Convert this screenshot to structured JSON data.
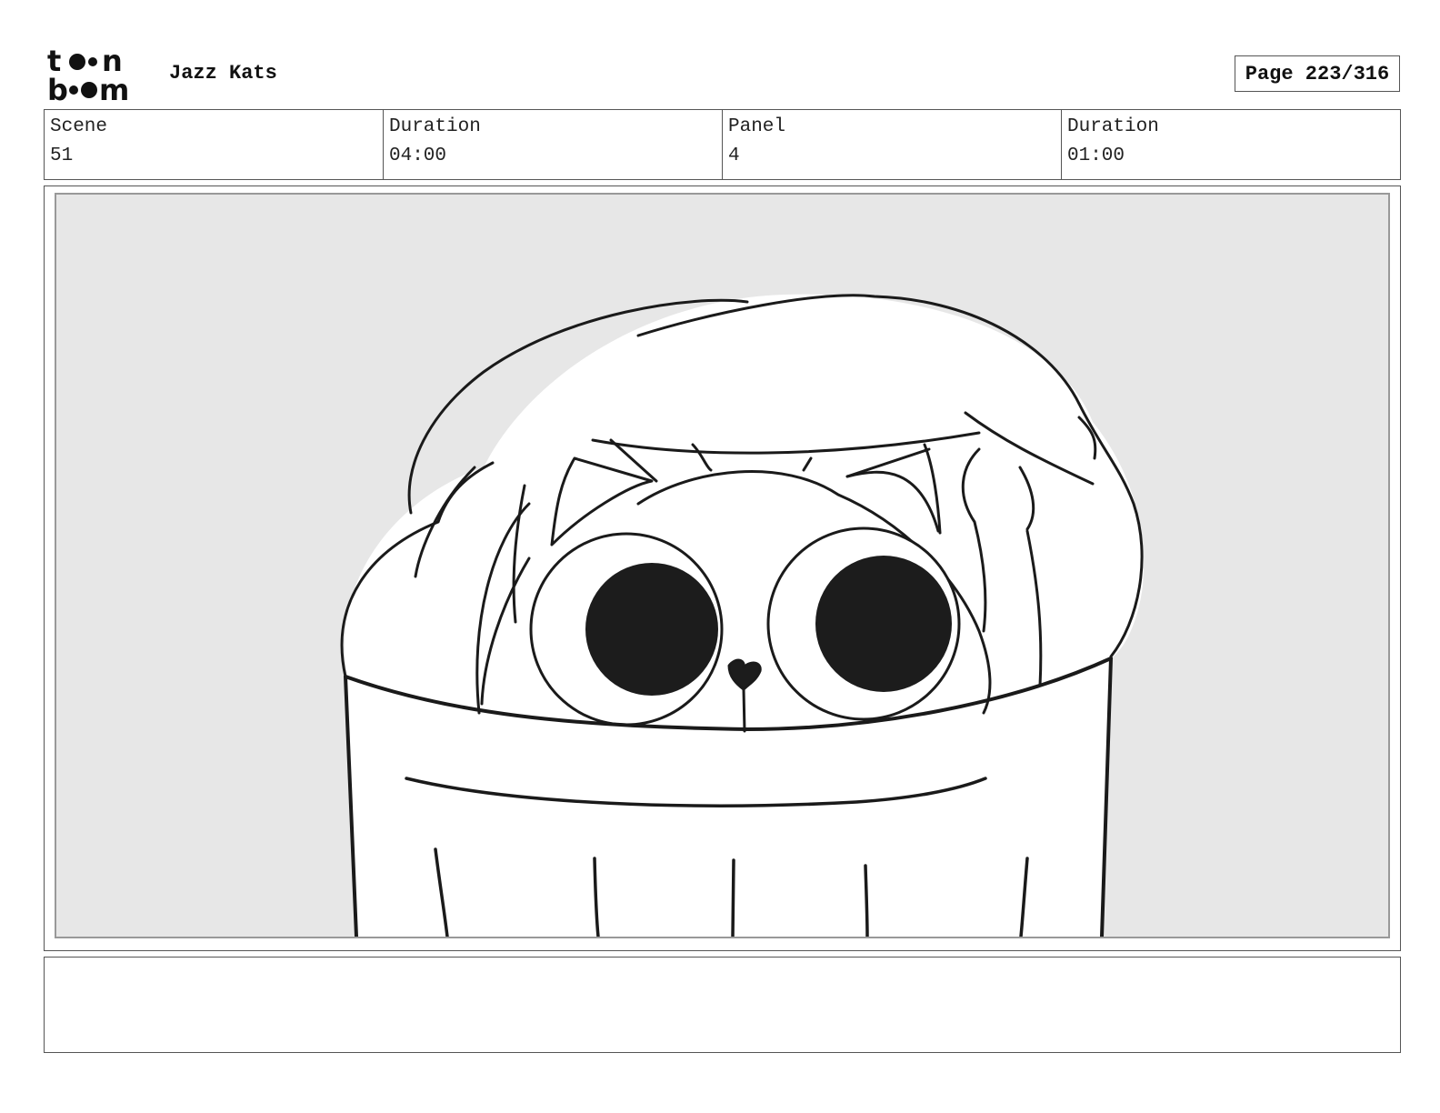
{
  "header": {
    "logo_alt": "toon boom",
    "project_title": "Jazz Kats",
    "page_label": "Page 223/316"
  },
  "info": {
    "scene_label": "Scene",
    "scene_value": "51",
    "scene_duration_label": "Duration",
    "scene_duration_value": "04:00",
    "panel_label": "Panel",
    "panel_value": "4",
    "panel_duration_label": "Duration",
    "panel_duration_value": "01:00"
  },
  "panel": {
    "background_color": "#e7e7e7",
    "line_color": "#1a1a1a"
  },
  "notes": {
    "text": ""
  }
}
